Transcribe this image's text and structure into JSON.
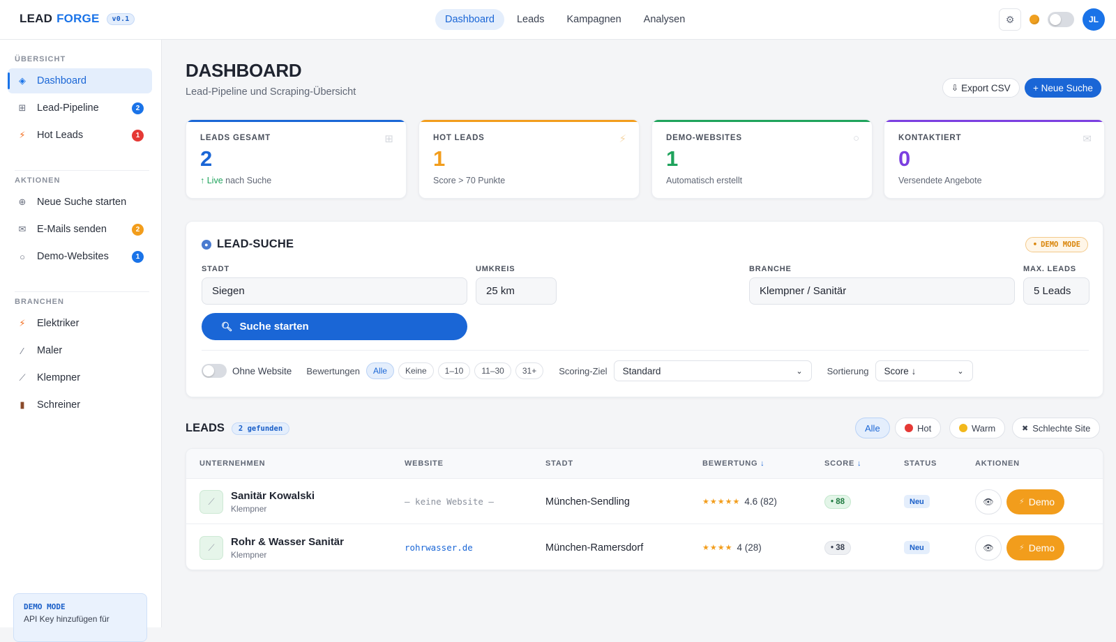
{
  "header": {
    "logo_lead": "LEAD",
    "logo_forge": "FORGE",
    "version": "v0.1",
    "nav": [
      {
        "label": "Dashboard"
      },
      {
        "label": "Leads"
      },
      {
        "label": "Kampagnen"
      },
      {
        "label": "Analysen"
      }
    ],
    "avatar_initials": "JL"
  },
  "sidebar": {
    "sections": [
      {
        "title": "ÜBERSICHT"
      },
      {
        "title": "AKTIONEN"
      },
      {
        "title": "BRANCHEN"
      }
    ],
    "items": [
      {
        "label": "Dashboard",
        "icon": "diamond-icon"
      },
      {
        "label": "Lead-Pipeline",
        "icon": "grid-icon",
        "badge": "2"
      },
      {
        "label": "Hot Leads",
        "icon": "lightning-icon",
        "badge": "1"
      },
      {
        "label": "Neue Suche starten",
        "icon": "globe-icon"
      },
      {
        "label": "E-Mails senden",
        "icon": "mail-icon",
        "badge": "2"
      },
      {
        "label": "Demo-Websites",
        "icon": "circle-icon",
        "badge": "1"
      },
      {
        "label": "Elektriker",
        "icon": "lightning-icon"
      },
      {
        "label": "Maler",
        "icon": "brush-icon"
      },
      {
        "label": "Klempner",
        "icon": "wrench-icon"
      },
      {
        "label": "Schreiner",
        "icon": "wood-icon"
      }
    ],
    "demo_box": {
      "title": "DEMO MODE",
      "text": "API Key hinzufügen für"
    }
  },
  "page": {
    "title": "DASHBOARD",
    "subtitle": "Lead-Pipeline und Scraping-Übersicht",
    "export_label": "Export CSV",
    "new_label": "+ Neue Suche"
  },
  "stats": [
    {
      "label": "LEADS GESAMT",
      "value": "2",
      "note_live": "Live",
      "note": "nach Suche",
      "color": "#1a66d6"
    },
    {
      "label": "HOT LEADS",
      "value": "1",
      "note": "Score > 70 Punkte",
      "color": "#f29d1c"
    },
    {
      "label": "DEMO-WEBSITES",
      "value": "1",
      "note": "Automatisch erstellt",
      "color": "#1fa35c"
    },
    {
      "label": "KONTAKTIERT",
      "value": "0",
      "note": "Versendete Angebote",
      "color": "#7b3fe0"
    }
  ],
  "search": {
    "title": "LEAD-SUCHE",
    "demo_mode": "DEMO MODE",
    "city_label": "STADT",
    "city_value": "Siegen",
    "radius_label": "UMKREIS",
    "radius_value": "25 km",
    "branch_label": "BRANCHE",
    "branch_value": "Klempner / Sanitär",
    "max_label": "MAX. LEADS",
    "max_value": "5 Leads",
    "button": "Suche starten",
    "no_website": "Ohne Website",
    "ratings_label": "Bewertungen",
    "rating_pills": [
      "Alle",
      "Keine",
      "1–10",
      "11–30",
      "31+"
    ],
    "scoring_label": "Scoring-Ziel",
    "scoring_value": "Standard",
    "sort_label": "Sortierung",
    "sort_value": "Score ↓"
  },
  "leads": {
    "title": "LEADS",
    "count": "2 gefunden",
    "filters": [
      "Alle",
      "Hot",
      "Warm",
      "Schlechte Site"
    ],
    "columns": [
      "UNTERNEHMEN",
      "WEBSITE",
      "STADT",
      "BEWERTUNG",
      "SCORE",
      "STATUS",
      "AKTIONEN"
    ],
    "rows": [
      {
        "name": "Sanitär Kowalski",
        "category": "Klempner",
        "website": "— keine Website —",
        "city": "München-Sendling",
        "stars": "★★★★★",
        "rating": "4.6 (82)",
        "score": "• 88",
        "status": "Neu",
        "demo": "Demo"
      },
      {
        "name": "Rohr & Wasser Sanitär",
        "category": "Klempner",
        "website": "rohrwasser.de",
        "city": "München-Ramersdorf",
        "stars": "★★★★",
        "rating": "4 (28)",
        "score": "• 38",
        "status": "Neu",
        "demo": "Demo"
      }
    ]
  }
}
